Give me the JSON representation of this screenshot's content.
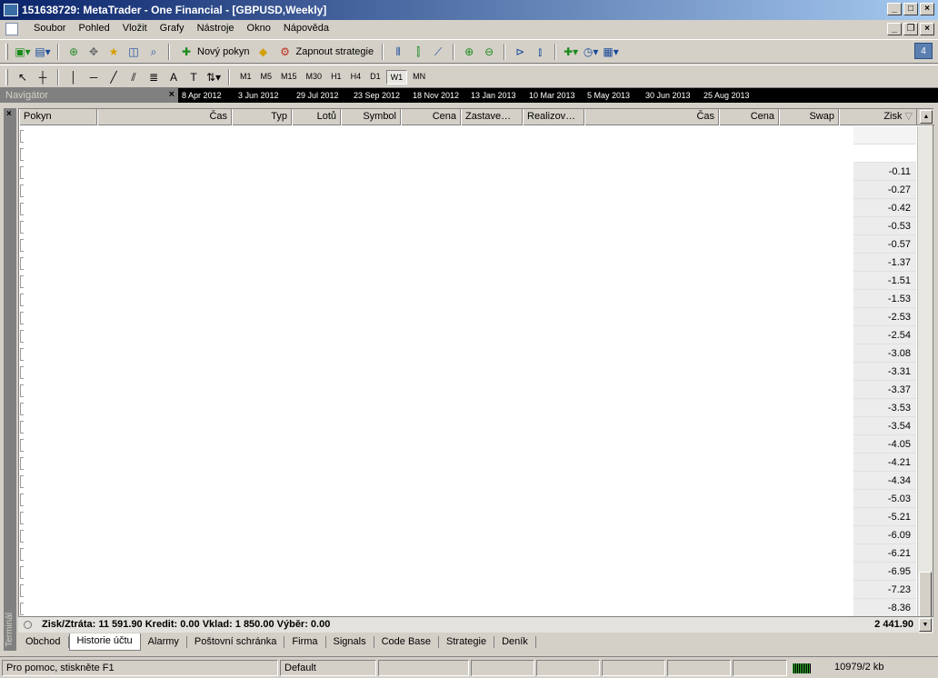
{
  "window": {
    "title": "151638729: MetaTrader - One Financial - [GBPUSD,Weekly]"
  },
  "menu": [
    "Soubor",
    "Pohled",
    "Vložit",
    "Grafy",
    "Nástroje",
    "Okno",
    "Nápověda"
  ],
  "toolbar": {
    "new_order": "Nový pokyn",
    "start_strategy": "Zapnout strategie",
    "notifications_count": "4",
    "timeframes": [
      "M1",
      "M5",
      "M15",
      "M30",
      "H1",
      "H4",
      "D1",
      "W1",
      "MN"
    ],
    "active_timeframe": "W1"
  },
  "navigator": {
    "label": "Navigátor"
  },
  "timeline": [
    "8 Apr 2012",
    "3 Jun 2012",
    "29 Jul 2012",
    "23 Sep 2012",
    "18 Nov 2012",
    "13 Jan 2013",
    "10 Mar 2013",
    "5 May 2013",
    "30 Jun 2013",
    "25 Aug 2013"
  ],
  "terminal": {
    "side_label": "Terminál",
    "columns": [
      "Pokyn",
      "Čas",
      "Typ",
      "Lotů",
      "Symbol",
      "Cena",
      "Zastave…",
      "Realizov…",
      "Čas",
      "Cena",
      "Swap",
      "Zisk"
    ],
    "profits": [
      "",
      "",
      "-0.11",
      "-0.27",
      "-0.42",
      "-0.53",
      "-0.57",
      "-1.37",
      "-1.51",
      "-1.53",
      "-2.53",
      "-2.54",
      "-3.08",
      "-3.31",
      "-3.37",
      "-3.53",
      "-3.54",
      "-4.05",
      "-4.21",
      "-4.34",
      "-5.03",
      "-5.21",
      "-6.09",
      "-6.21",
      "-6.95",
      "-7.23",
      "-8.36"
    ],
    "summary": "Zisk/Ztráta: 11 591.90  Kredit: 0.00  Vklad: 1 850.00  Výběr: 0.00",
    "total": "2 441.90",
    "tabs": [
      "Obchod",
      "Historie účtu",
      "Alarmy",
      "Poštovní schránka",
      "Firma",
      "Signals",
      "Code Base",
      "Strategie",
      "Deník"
    ],
    "active_tab": "Historie účtu"
  },
  "status": {
    "help": "Pro pomoc, stiskněte F1",
    "profile": "Default",
    "connection": "10979/2 kb"
  }
}
